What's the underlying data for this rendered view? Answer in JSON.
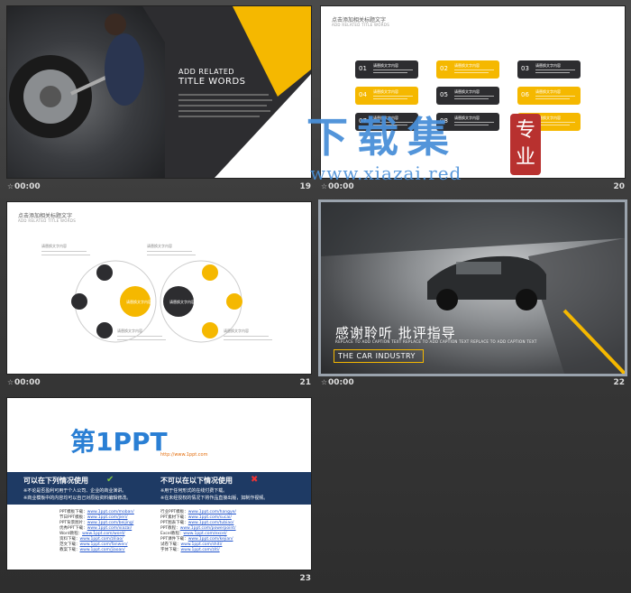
{
  "slides": [
    {
      "num": "19",
      "time": "00:00",
      "add_related": "ADD RELATED",
      "title_words": "TITLE WORDS"
    },
    {
      "num": "20",
      "time": "00:00",
      "header": "点击添加相关标题文字",
      "header_sub": "ADD RELATED TITLE WORDS",
      "items": [
        {
          "n": "01",
          "label": "请替换文字内容"
        },
        {
          "n": "02",
          "label": "请替换文字内容"
        },
        {
          "n": "03",
          "label": "请替换文字内容"
        },
        {
          "n": "04",
          "label": "请替换文字内容"
        },
        {
          "n": "05",
          "label": "请替换文字内容"
        },
        {
          "n": "06",
          "label": "请替换文字内容"
        },
        {
          "n": "07",
          "label": "请替换文字内容"
        },
        {
          "n": "08",
          "label": "请替换文字内容"
        },
        {
          "n": "09",
          "label": "请替换文字内容"
        }
      ]
    },
    {
      "num": "21",
      "time": "00:00",
      "header": "点击添加相关标题文字",
      "header_sub": "ADD RELATED TITLE WORDS",
      "label_a": "请替换文字内容",
      "label_b": "请替换文字内容",
      "label_c": "请替换文字内容",
      "label_d": "请替换文字内容",
      "circle_big_1": "请替换文字内容",
      "circle_big_2": "请替换文字内容",
      "circle_small": "请替换文字内容"
    },
    {
      "num": "22",
      "time": "00:00",
      "title": "感谢聆听 批评指导",
      "sub": "REPLACE TO ADD CAPTION TEXT REPLACE TO ADD CAPTION TEXT REPLACE TO ADD CAPTION TEXT",
      "box": "THE CAR INDUSTRY"
    },
    {
      "num": "23",
      "logo_main": "第1PPT",
      "logo_url": "http://www.1ppt.com",
      "can_title": "可以在下列情况使用",
      "cannot_title": "不可以在以下情况使用",
      "can_1": "※不论是否盈利可用于个人公司、企业的商业演讲。",
      "can_2": "※商业模板中的内容均可以自己对原始资料编辑修改。",
      "cannot_1": "※用于任何形式的在线付费下载。",
      "cannot_2": "※在未经授权的情况下将作品直接出版，如制作视频。",
      "links_left": [
        {
          "k": "PPT模板下载：",
          "v": "www.1ppt.com/moban/"
        },
        {
          "k": "节日PPT模板：",
          "v": "www.1ppt.com/jieri/"
        },
        {
          "k": "PPT背景图片：",
          "v": "www.1ppt.com/beijing/"
        },
        {
          "k": "优秀PPT下载：",
          "v": "www.1ppt.com/xiazai/"
        },
        {
          "k": "Word教程：",
          "v": "www.1ppt.com/word/"
        },
        {
          "k": "资料下载：",
          "v": "www.1ppt.com/ziliao/"
        },
        {
          "k": "范文下载：",
          "v": "www.1ppt.com/fanwen/"
        },
        {
          "k": "教案下载：",
          "v": "www.1ppt.com/jiaoan/"
        }
      ],
      "links_right": [
        {
          "k": "行业PPT模板：",
          "v": "www.1ppt.com/hangye/"
        },
        {
          "k": "PPT素材下载：",
          "v": "www.1ppt.com/sucai/"
        },
        {
          "k": "PPT图表下载：",
          "v": "www.1ppt.com/tubiao/"
        },
        {
          "k": "PPT教程：",
          "v": "www.1ppt.com/powerpoint/"
        },
        {
          "k": "Excel教程：",
          "v": "www.1ppt.com/excel/"
        },
        {
          "k": "PPT课件下载：",
          "v": "www.1ppt.com/kejian/"
        },
        {
          "k": "试卷下载：",
          "v": "www.1ppt.com/shiti/"
        },
        {
          "k": "字体下载：",
          "v": "www.1ppt.com/ziti/"
        }
      ]
    }
  ],
  "watermark": {
    "text": "下载集",
    "url": "www.xiazai.red",
    "seal": "专业"
  },
  "colors": {
    "yellow": "#f5b800",
    "dark": "#2d2d30",
    "navy": "#1e3a64",
    "watermark_blue": "#4a90d9"
  }
}
